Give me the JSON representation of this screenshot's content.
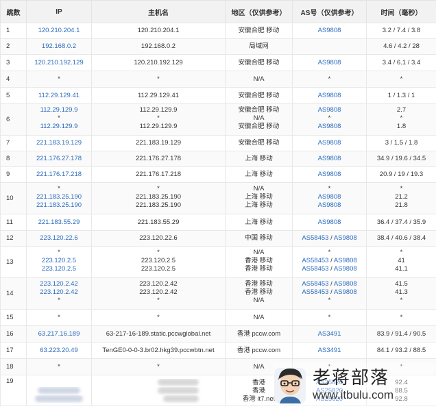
{
  "headers": {
    "hop": "跳数",
    "ip": "IP",
    "host": "主机名",
    "region": "地区（仅供参考）",
    "as": "AS号（仅供参考）",
    "time": "时间（毫秒）"
  },
  "rows": [
    {
      "hop": "1",
      "ip": [
        "120.210.204.1"
      ],
      "host": [
        "120.210.204.1"
      ],
      "region": [
        "安徽合肥 移动"
      ],
      "as": [
        "AS9808"
      ],
      "time": [
        "3.2 / 7.4 / 3.8"
      ]
    },
    {
      "hop": "2",
      "ip": [
        "192.168.0.2"
      ],
      "host": [
        "192.168.0.2"
      ],
      "region": [
        "局域网"
      ],
      "as": [
        ""
      ],
      "time": [
        "4.6 / 4.2 / 28"
      ]
    },
    {
      "hop": "3",
      "ip": [
        "120.210.192.129"
      ],
      "host": [
        "120.210.192.129"
      ],
      "region": [
        "安徽合肥 移动"
      ],
      "as": [
        "AS9808"
      ],
      "time": [
        "3.4 / 6.1 / 3.4"
      ]
    },
    {
      "hop": "4",
      "ip": [
        "*"
      ],
      "host": [
        "*"
      ],
      "region": [
        "N/A"
      ],
      "as": [
        "*"
      ],
      "time": [
        "*"
      ]
    },
    {
      "hop": "5",
      "ip": [
        "112.29.129.41"
      ],
      "host": [
        "112.29.129.41"
      ],
      "region": [
        "安徽合肥 移动"
      ],
      "as": [
        "AS9808"
      ],
      "time": [
        "1 / 1.3 / 1"
      ]
    },
    {
      "hop": "6",
      "ip": [
        "112.29.129.9",
        "*",
        "112.29.129.9"
      ],
      "host": [
        "112.29.129.9",
        "*",
        "112.29.129.9"
      ],
      "region": [
        "安徽合肥 移动",
        "N/A",
        "安徽合肥 移动"
      ],
      "as": [
        "AS9808",
        "*",
        "AS9808"
      ],
      "time": [
        "2.7",
        "*",
        "1.8"
      ]
    },
    {
      "hop": "7",
      "ip": [
        "221.183.19.129"
      ],
      "host": [
        "221.183.19.129"
      ],
      "region": [
        "安徽合肥 移动"
      ],
      "as": [
        "AS9808"
      ],
      "time": [
        "3 / 1.5 / 1.8"
      ]
    },
    {
      "hop": "8",
      "ip": [
        "221.176.27.178"
      ],
      "host": [
        "221.176.27.178"
      ],
      "region": [
        "上海 移动"
      ],
      "as": [
        "AS9808"
      ],
      "time": [
        "34.9 / 19.6 / 34.5"
      ]
    },
    {
      "hop": "9",
      "ip": [
        "221.176.17.218"
      ],
      "host": [
        "221.176.17.218"
      ],
      "region": [
        "上海 移动"
      ],
      "as": [
        "AS9808"
      ],
      "time": [
        "20.9 / 19 / 19.3"
      ]
    },
    {
      "hop": "10",
      "ip": [
        "*",
        "221.183.25.190",
        "221.183.25.190"
      ],
      "host": [
        "*",
        "221.183.25.190",
        "221.183.25.190"
      ],
      "region": [
        "N/A",
        "上海 移动",
        "上海 移动"
      ],
      "as": [
        "*",
        "AS9808",
        "AS9808"
      ],
      "time": [
        "*",
        "21.2",
        "21.8"
      ]
    },
    {
      "hop": "11",
      "ip": [
        "221.183.55.29"
      ],
      "host": [
        "221.183.55.29"
      ],
      "region": [
        "上海 移动"
      ],
      "as": [
        "AS9808"
      ],
      "time": [
        "36.4 / 37.4 / 35.9"
      ]
    },
    {
      "hop": "12",
      "ip": [
        "223.120.22.6"
      ],
      "host": [
        "223.120.22.6"
      ],
      "region": [
        "中国 移动"
      ],
      "as": [
        "AS58453 / AS9808"
      ],
      "time": [
        "38.4 / 40.6 / 38.4"
      ]
    },
    {
      "hop": "13",
      "ip": [
        "*",
        "223.120.2.5",
        "223.120.2.5"
      ],
      "host": [
        "*",
        "223.120.2.5",
        "223.120.2.5"
      ],
      "region": [
        "N/A",
        "香港 移动",
        "香港 移动"
      ],
      "as": [
        "*",
        "AS58453 / AS9808",
        "AS58453 / AS9808"
      ],
      "time": [
        "*",
        "41",
        "41.1"
      ]
    },
    {
      "hop": "14",
      "ip": [
        "223.120.2.42",
        "223.120.2.42",
        "*"
      ],
      "host": [
        "223.120.2.42",
        "223.120.2.42",
        "*"
      ],
      "region": [
        "香港 移动",
        "香港 移动",
        "N/A"
      ],
      "as": [
        "AS58453 / AS9808",
        "AS58453 / AS9808",
        "*"
      ],
      "time": [
        "41.5",
        "41.3",
        "*"
      ]
    },
    {
      "hop": "15",
      "ip": [
        "*"
      ],
      "host": [
        "*"
      ],
      "region": [
        "N/A"
      ],
      "as": [
        "*"
      ],
      "time": [
        "*"
      ]
    },
    {
      "hop": "16",
      "ip": [
        "63.217.16.189"
      ],
      "host": [
        "63-217-16-189.static.pccwglobal.net"
      ],
      "region": [
        "香港 pccw.com"
      ],
      "as": [
        "AS3491"
      ],
      "time": [
        "83.9 / 91.4 / 90.5"
      ]
    },
    {
      "hop": "17",
      "ip": [
        "63.223.20.49"
      ],
      "host": [
        "TenGE0-0-0-3.br02.hkg39.pccwbtn.net"
      ],
      "region": [
        "香港 pccw.com"
      ],
      "as": [
        "AS3491"
      ],
      "time": [
        "84.1 / 93.2 / 88.5"
      ]
    },
    {
      "hop": "18",
      "ip": [
        "*"
      ],
      "host": [
        "*"
      ],
      "region": [
        "N/A"
      ],
      "as": [
        "*"
      ],
      "time": [
        "*"
      ]
    },
    {
      "hop": "19",
      "ip": [
        "",
        ""
      ],
      "host": [
        "...s.com",
        "...s.com",
        "...6clouds.com"
      ],
      "region": [
        "香港",
        "香港",
        "香港 it7.net"
      ],
      "as": [
        "AS25820",
        "AS25820",
        "AS25820"
      ],
      "time": [
        "92.4",
        "88.5",
        "92.8"
      ]
    }
  ],
  "watermark": {
    "name": "老蒋部落",
    "url": "www.itbulu.com"
  }
}
